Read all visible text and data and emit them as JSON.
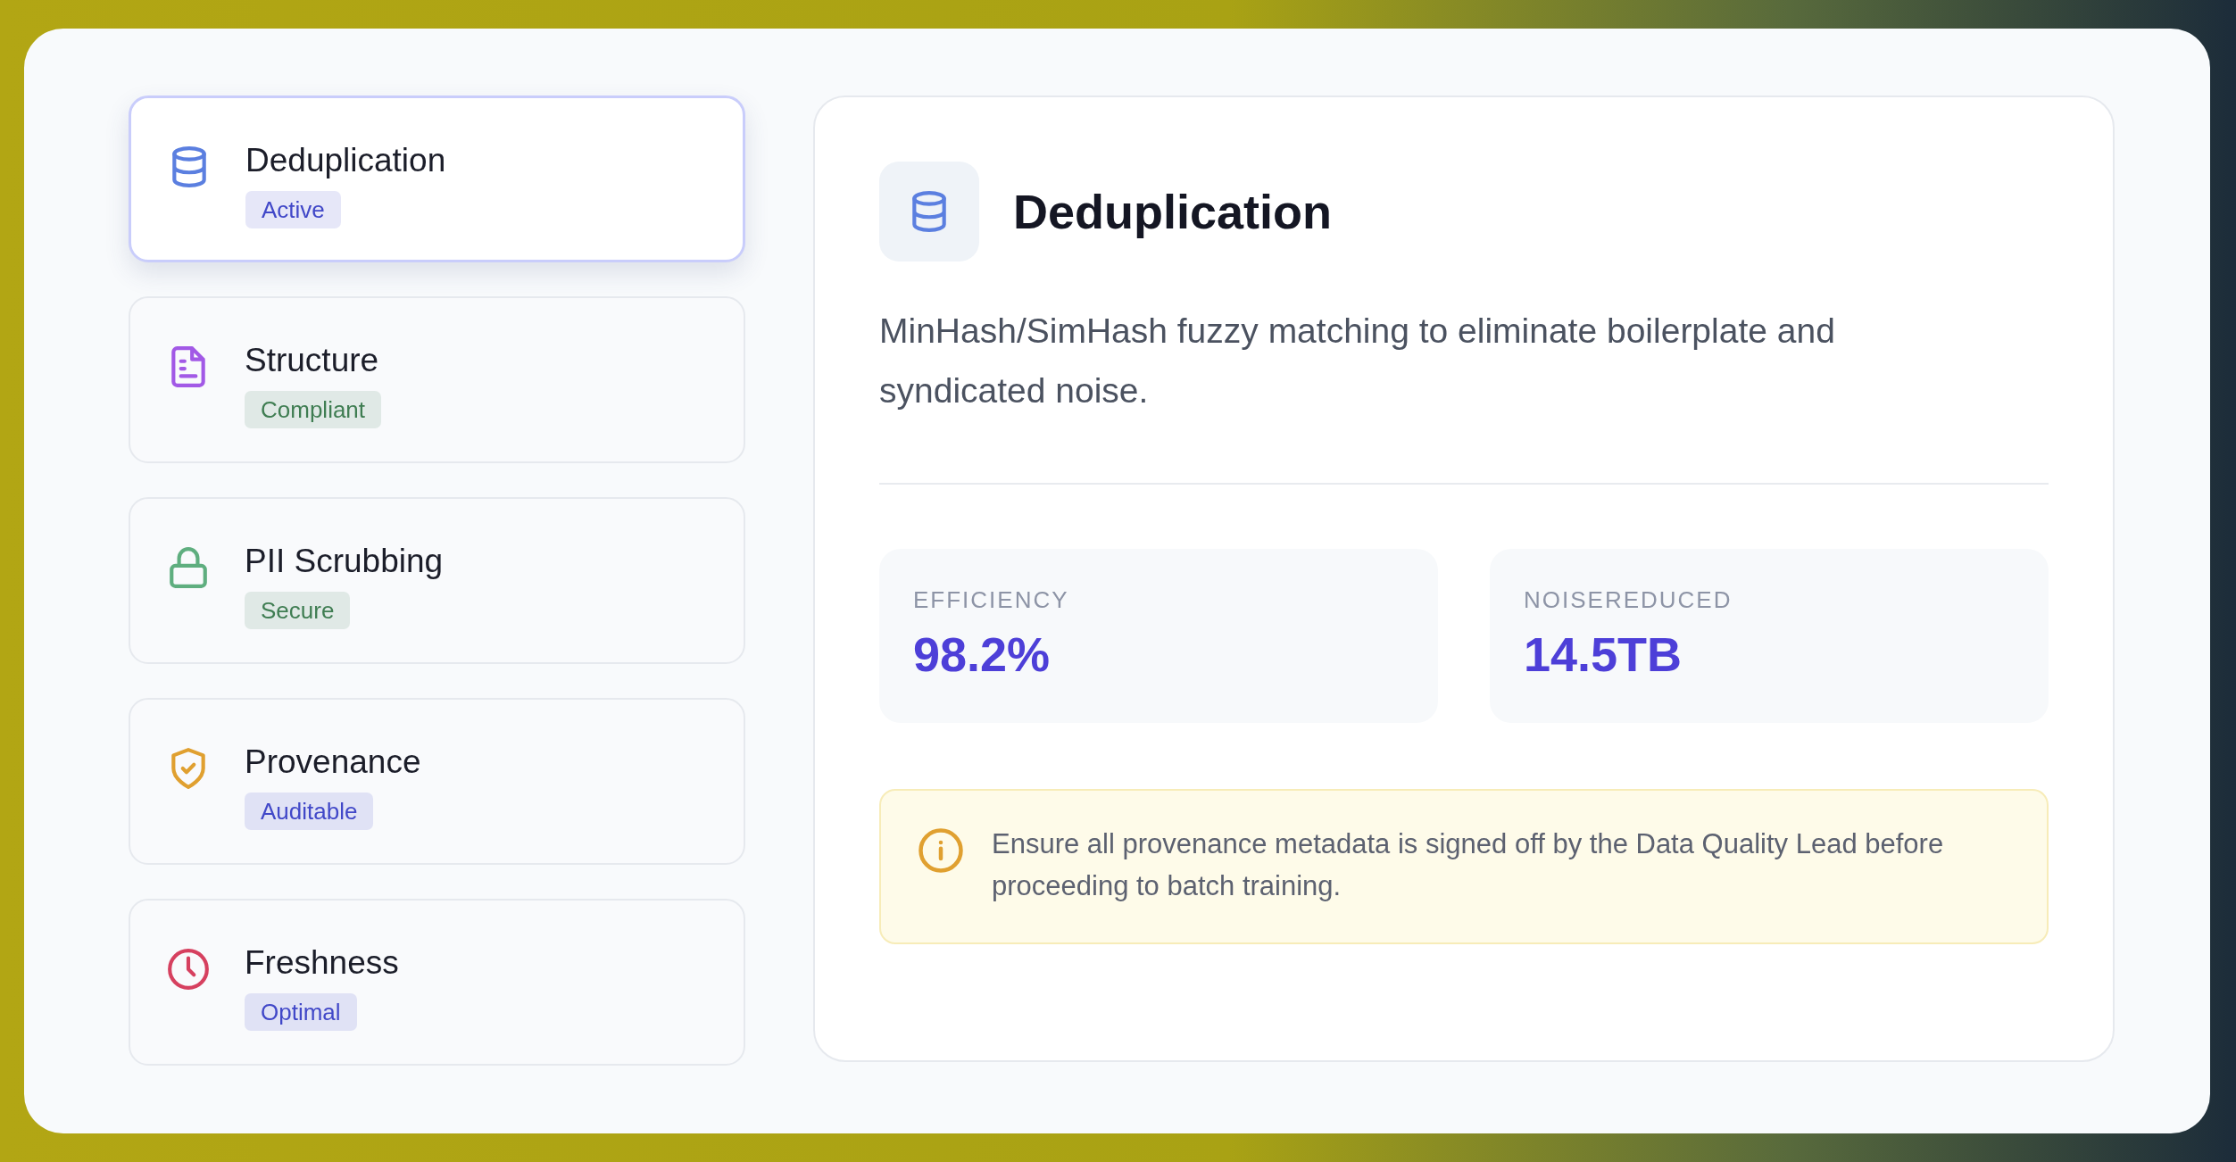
{
  "items": [
    {
      "kind": "database",
      "title": "Deduplication",
      "color": "#5b7fe0",
      "selected": true,
      "badge": {
        "text": "Active",
        "color": "#4148c8"
      }
    },
    {
      "kind": "document",
      "title": "Structure",
      "color": "#a259e6",
      "selected": false,
      "badge": {
        "text": "Compliant",
        "color": "#3f7d52"
      }
    },
    {
      "kind": "lock",
      "title": "PII Scrubbing",
      "color": "#5fae7f",
      "selected": false,
      "badge": {
        "text": "Secure",
        "color": "#3f7d52"
      }
    },
    {
      "kind": "shield",
      "title": "Provenance",
      "color": "#e0a030",
      "selected": false,
      "badge": {
        "text": "Auditable",
        "color": "#4148c8"
      }
    },
    {
      "kind": "clock",
      "title": "Freshness",
      "color": "#d6405f",
      "selected": false,
      "badge": {
        "text": "Optimal",
        "color": "#4148c8"
      }
    }
  ],
  "detail": {
    "kind": "database",
    "color": "#5b7fe0",
    "title": "Deduplication",
    "description": "MinHash/SimHash fuzzy matching to eliminate boilerplate and syndicated noise.",
    "stats": [
      {
        "label": "EFFICIENCY",
        "value": "98.2%"
      },
      {
        "label": "NOISEREDUCED",
        "value": "14.5TB"
      }
    ],
    "notice": "Ensure all provenance metadata is signed off by the Data Quality Lead before proceeding to batch training."
  }
}
